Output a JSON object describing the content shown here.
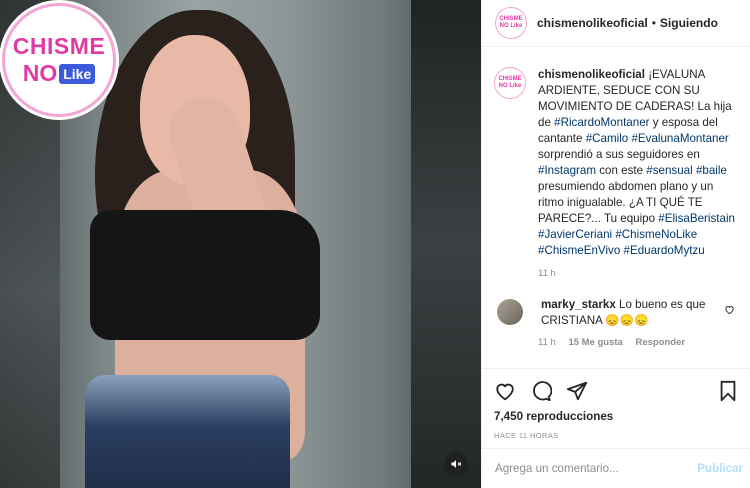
{
  "post": {
    "username": "chismenolikeoficial",
    "separator": "•",
    "follow_status": "Siguiendo"
  },
  "logo": {
    "line1": "CHISME",
    "line2a": "NO",
    "line2b": "Like",
    "small1": "CHISME",
    "small2": "NO Like"
  },
  "caption": {
    "username": "chismenolikeoficial",
    "text1": " ¡EVALUNA ARDIENTE, SEDUCE CON SU MOVIMIENTO DE CADERAS! La hija de ",
    "tag1": "#RicardoMontaner",
    "text2": " y esposa del cantante ",
    "tag2": "#Camilo",
    "tag3": "#EvalunaMontaner",
    "text3": " sorprendió a sus seguidores en ",
    "tag4": "#Instagram",
    "text4": " con este ",
    "tag5": "#sensual",
    "tag6": "#baile",
    "text5": " presumiendo abdomen plano y un ritmo inigualable. ¿A TI QUÉ TE PARECE?... Tu equipo ",
    "tag7": "#ElisaBeristain",
    "tag8": "#JavierCeriani",
    "tag9": "#ChismeNoLike",
    "tag10": "#ChismeEnVivo",
    "tag11": "#EduardoMytzu",
    "time": "11 h"
  },
  "comment": {
    "username": "marky_starkx",
    "text": " Lo bueno es que CRISTIANA 😞😞😞",
    "time": "11 h",
    "likes": "15 Me gusta",
    "reply": "Responder"
  },
  "stats": {
    "views": "7,450 reproducciones",
    "ago": "HACE 11 HORAS"
  },
  "composer": {
    "placeholder": "Agrega un comentario...",
    "publish": "Publicar"
  },
  "icons": [
    "heart-icon",
    "comment-icon",
    "share-icon",
    "bookmark-icon",
    "mute-icon",
    "heart-small-icon"
  ],
  "colors": {
    "brand_pink": "#e23aa4",
    "link": "#00376b",
    "muted": "#8e8e8e",
    "publish_disabled": "#b2dffc"
  }
}
